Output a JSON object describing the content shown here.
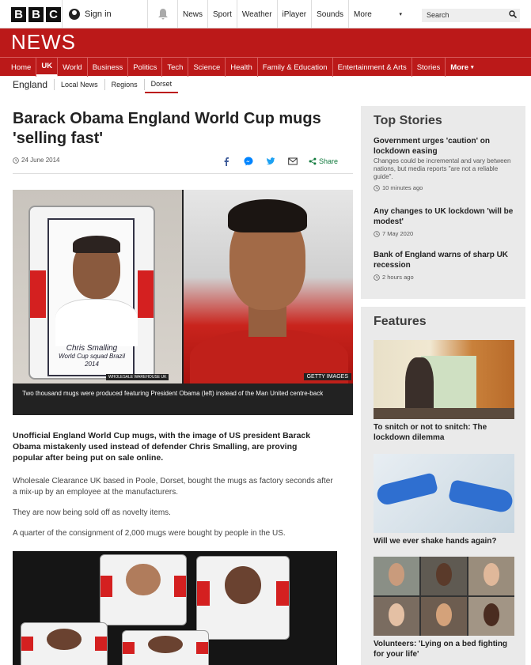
{
  "header": {
    "logo_letters": [
      "B",
      "B",
      "C"
    ],
    "signin_label": "Sign in",
    "links": [
      "News",
      "Sport",
      "Weather",
      "iPlayer",
      "Sounds"
    ],
    "more_label": "More",
    "search_placeholder": "Search"
  },
  "brand": {
    "wordmark": "NEWS",
    "color": "#bb1919"
  },
  "nav": {
    "items": [
      "Home",
      "UK",
      "World",
      "Business",
      "Politics",
      "Tech",
      "Science",
      "Health",
      "Family & Education",
      "Entertainment & Arts",
      "Stories",
      "More"
    ],
    "active": "UK"
  },
  "subnav": {
    "region": "England",
    "items": [
      "Local News",
      "Regions",
      "Dorset"
    ],
    "active": "Dorset"
  },
  "article": {
    "headline": "Barack Obama England World Cup mugs 'selling fast'",
    "date": "24 June 2014",
    "share_label": "Share",
    "image_caption": "Two thousand mugs were produced featuring President Obama (left) instead of the Man United centre-back",
    "image_credit_right": "GETTY IMAGES",
    "image_credit_left": "WHOLESALE WAREHOUSE UK",
    "mug_text_line1": "Chris Smalling",
    "mug_text_line2": "World Cup squad Brazil 2014",
    "intro": "Unofficial England World Cup mugs, with the image of US president Barack Obama mistakenly used instead of defender Chris Smalling, are proving popular after being put on sale online.",
    "paragraphs": [
      "Wholesale Clearance UK based in Poole, Dorset, bought the mugs as factory seconds after a mix-up by an employee at the manufacturers.",
      "They are now being sold off as novelty items.",
      "A quarter of the consignment of 2,000 mugs were bought by people in the US."
    ]
  },
  "top_stories": {
    "heading": "Top Stories",
    "items": [
      {
        "title": "Government urges 'caution' on lockdown easing",
        "summary": "Changes could be incremental and vary between nations, but media reports \"are not a reliable guide\".",
        "time": "10 minutes ago"
      },
      {
        "title": "Any changes to UK lockdown 'will be modest'",
        "summary": "",
        "time": "7 May 2020"
      },
      {
        "title": "Bank of England warns of sharp UK recession",
        "summary": "",
        "time": "2 hours ago"
      }
    ]
  },
  "features": {
    "heading": "Features",
    "items": [
      {
        "title": "To snitch or not to snitch: The lockdown dilemma"
      },
      {
        "title": "Will we ever shake hands again?"
      },
      {
        "title": "Volunteers: 'Lying on a bed fighting for your life'"
      }
    ]
  }
}
